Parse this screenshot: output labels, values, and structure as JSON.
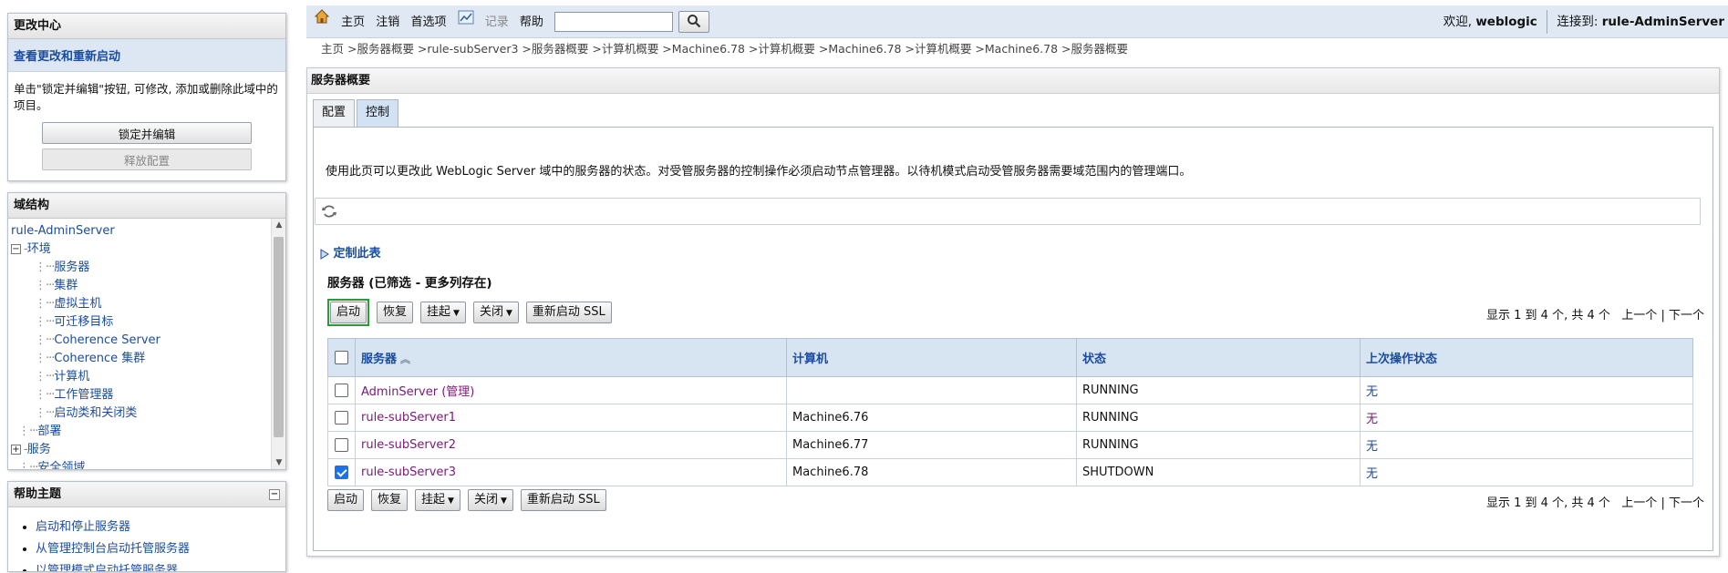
{
  "change_center": {
    "title": "更改中心",
    "view_changes": "查看更改和重新启动",
    "instructions": "单击\"锁定并编辑\"按钮, 可修改, 添加或删除此域中的项目。",
    "lock_button": "锁定并编辑",
    "release_button": "释放配置"
  },
  "domain_structure": {
    "title": "域结构",
    "root": "rule-AdminServer",
    "env": "环境",
    "children": [
      "服务器",
      "集群",
      "虚拟主机",
      "可迁移目标",
      "Coherence Server",
      "Coherence 集群",
      "计算机",
      "工作管理器",
      "启动类和关闭类"
    ],
    "deploy": "部署",
    "services": "服务",
    "security": "安全领域"
  },
  "help": {
    "title": "帮助主题",
    "collapse": "⊟",
    "items": [
      "启动和停止服务器",
      "从管理控制台启动托管服务器",
      "以管理模式启动托管服务器"
    ]
  },
  "topbar": {
    "home": "主页",
    "logout": "注销",
    "preferences": "首选项",
    "record": "记录",
    "help": "帮助",
    "search_value": "",
    "welcome": "欢迎,",
    "user": "weblogic",
    "connected": "连接到:",
    "server": "rule-AdminServer"
  },
  "breadcrumb": "主页 >服务器概要 >rule-subServer3 >服务器概要 >计算机概要 >Machine6.78 >计算机概要 >Machine6.78 >计算机概要 >Machine6.78 >服务器概要",
  "main": {
    "title": "服务器概要",
    "tabs": [
      "配置",
      "控制"
    ],
    "description": "使用此页可以更改此 WebLogic Server 域中的服务器的状态。对受管服务器的控制操作必须启动节点管理器。以待机模式启动受管服务器需要域范围内的管理端口。",
    "customize": "定制此表",
    "table_title": "服务器 (已筛选 - 更多列存在)",
    "actions": {
      "start": "启动",
      "resume": "恢复",
      "suspend": "挂起",
      "shutdown": "关闭",
      "restart_ssl": "重新启动 SSL"
    },
    "pager": {
      "showing": "显示 1 到 4 个, 共 4 个",
      "prev": "上一个",
      "sep": "|",
      "next": "下一个"
    },
    "columns": [
      "服务器",
      "计算机",
      "状态",
      "上次操作状态"
    ],
    "rows": [
      {
        "server": "AdminServer (管理)",
        "machine": "",
        "state": "RUNNING",
        "last": "无",
        "checked": false
      },
      {
        "server": "rule-subServer1",
        "machine": "Machine6.76",
        "state": "RUNNING",
        "last": "无",
        "checked": false
      },
      {
        "server": "rule-subServer2",
        "machine": "Machine6.77",
        "state": "RUNNING",
        "last": "无",
        "checked": false
      },
      {
        "server": "rule-subServer3",
        "machine": "Machine6.78",
        "state": "SHUTDOWN",
        "last": "无",
        "checked": true
      }
    ]
  }
}
